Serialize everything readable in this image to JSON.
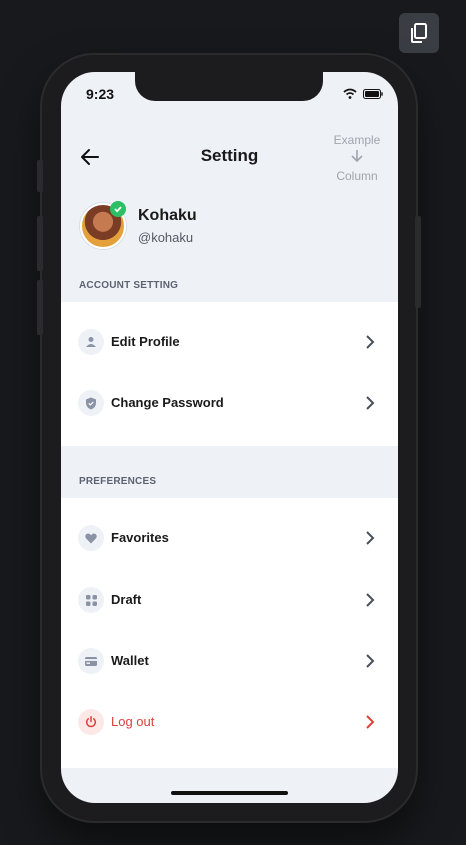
{
  "status": {
    "time": "9:23"
  },
  "header": {
    "title": "Setting",
    "example_top": "Example",
    "example_bottom": "Column"
  },
  "profile": {
    "name": "Kohaku",
    "handle": "@kohaku"
  },
  "account_section": {
    "title": "ACCOUNT SETTING",
    "items": [
      {
        "label": "Edit Profile",
        "icon": "person-icon"
      },
      {
        "label": "Change Password",
        "icon": "shield-icon"
      }
    ]
  },
  "preferences_section": {
    "title": "PREFERENCES",
    "items": [
      {
        "label": "Favorites",
        "icon": "heart-icon"
      },
      {
        "label": "Draft",
        "icon": "grid-icon"
      },
      {
        "label": "Wallet",
        "icon": "card-icon"
      },
      {
        "label": "Log out",
        "icon": "power-icon"
      }
    ]
  },
  "colors": {
    "accent_red": "#d9433a",
    "verified_green": "#2dbf63",
    "icon_gray": "#8a93a6"
  }
}
